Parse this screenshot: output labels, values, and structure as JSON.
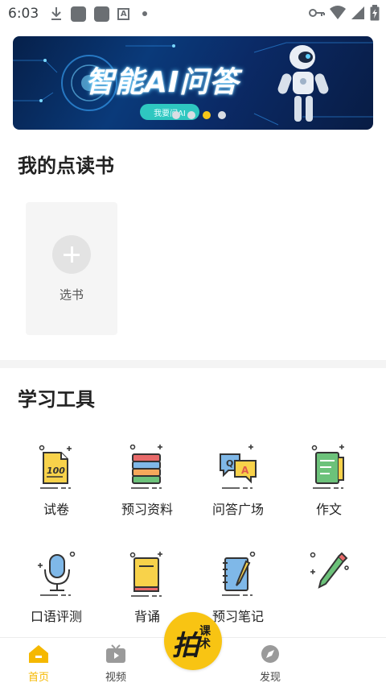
{
  "status_bar": {
    "time": "6:03",
    "letter_icon": "A"
  },
  "banner": {
    "title": "智能AI问答",
    "button_label": "我要问AI",
    "dots_count": 4,
    "active_dot": 2
  },
  "my_books": {
    "title": "我的点读书",
    "add_label": "选书"
  },
  "tools": {
    "title": "学习工具",
    "items": [
      {
        "label": "试卷",
        "icon": "exam-paper-icon"
      },
      {
        "label": "预习资料",
        "icon": "books-stack-icon"
      },
      {
        "label": "问答广场",
        "icon": "qa-bubbles-icon"
      },
      {
        "label": "作文",
        "icon": "essay-doc-icon"
      },
      {
        "label": "口语评测",
        "icon": "microphone-icon"
      },
      {
        "label": "背诵",
        "icon": "recite-book-icon"
      },
      {
        "label": "预习笔记",
        "icon": "notebook-pencil-icon"
      },
      {
        "label": "",
        "icon": "pencil-icon"
      }
    ]
  },
  "bottom_nav": {
    "home": "首页",
    "video": "视频",
    "center_main": "拍",
    "center_sub": "课术",
    "discover": "发现"
  },
  "colors": {
    "accent": "#f5b800",
    "center_button": "#f8c413",
    "banner_button": "#2ec7c0"
  }
}
